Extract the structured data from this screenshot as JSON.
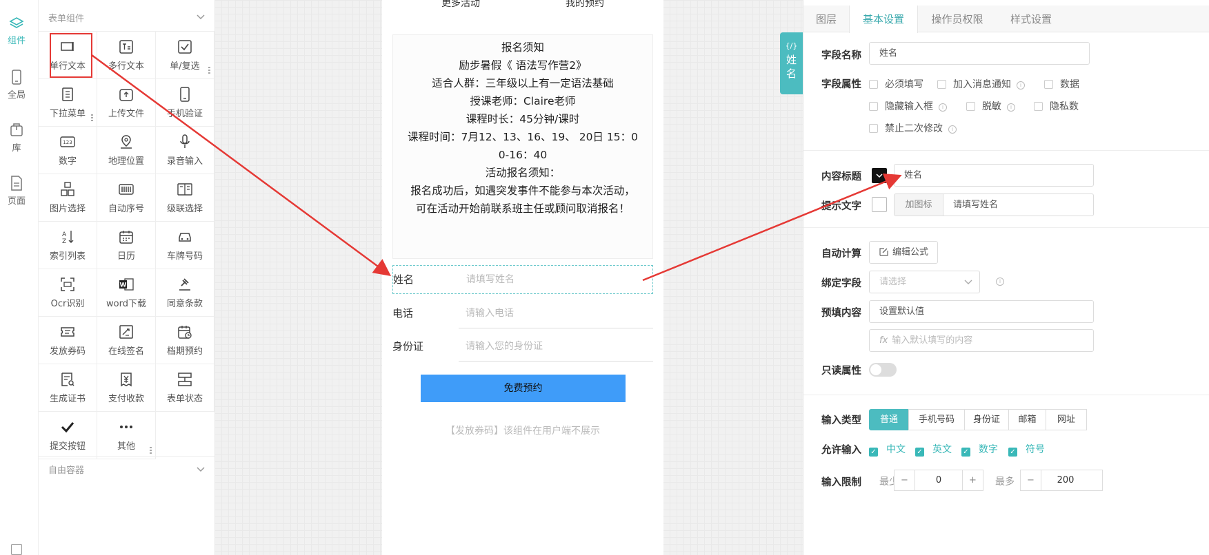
{
  "rail": {
    "items": [
      {
        "label": "组件",
        "icon": "layers-icon"
      },
      {
        "label": "全局",
        "icon": "phone-icon"
      },
      {
        "label": "库",
        "icon": "package-icon"
      },
      {
        "label": "页面",
        "icon": "page-icon"
      }
    ]
  },
  "palette": {
    "form_section": "表单组件",
    "free_section": "自由容器",
    "items": [
      {
        "label": "单行文本",
        "icon": "single-line-text-icon"
      },
      {
        "label": "多行文本",
        "icon": "multi-line-text-icon"
      },
      {
        "label": "单/复选",
        "icon": "checkbox-icon"
      },
      {
        "label": "下拉菜单",
        "icon": "dropdown-icon"
      },
      {
        "label": "上传文件",
        "icon": "upload-icon"
      },
      {
        "label": "手机验证",
        "icon": "mobile-icon"
      },
      {
        "label": "数字",
        "icon": "number-icon"
      },
      {
        "label": "地理位置",
        "icon": "location-icon"
      },
      {
        "label": "录音输入",
        "icon": "microphone-icon"
      },
      {
        "label": "图片选择",
        "icon": "image-select-icon"
      },
      {
        "label": "自动序号",
        "icon": "barcode-icon"
      },
      {
        "label": "级联选择",
        "icon": "cascade-icon"
      },
      {
        "label": "索引列表",
        "icon": "sort-az-icon"
      },
      {
        "label": "日历",
        "icon": "calendar-icon"
      },
      {
        "label": "车牌号码",
        "icon": "car-icon"
      },
      {
        "label": "Ocr识别",
        "icon": "ocr-scan-icon"
      },
      {
        "label": "word下载",
        "icon": "word-icon"
      },
      {
        "label": "同意条款",
        "icon": "gavel-icon"
      },
      {
        "label": "发放券码",
        "icon": "coupon-icon"
      },
      {
        "label": "在线签名",
        "icon": "signature-icon"
      },
      {
        "label": "档期预约",
        "icon": "schedule-icon"
      },
      {
        "label": "生成证书",
        "icon": "certificate-icon"
      },
      {
        "label": "支付收款",
        "icon": "payment-icon"
      },
      {
        "label": "表单状态",
        "icon": "form-status-icon"
      },
      {
        "label": "提交按钮",
        "icon": "checkmark-icon"
      },
      {
        "label": "其他",
        "icon": "more-icon"
      }
    ]
  },
  "canvas": {
    "top_links": [
      "更多活动",
      "我的预约"
    ],
    "notice_lines": [
      "报名须知",
      "励步暑假《 语法写作营2》",
      "适合人群：三年级以上有一定语法基础",
      "授课老师：Claire老师",
      "课程时长：45分钟/课时",
      "课程时间：7月12、13、16、19、 20日   15：0",
      "0-16：40",
      "活动报名须知：",
      "报名成功后，如遇突发事件不能参与本次活动，",
      "可在活动开始前联系班主任或顾问取消报名！"
    ],
    "fields": [
      {
        "label": "姓名",
        "placeholder": "请填写姓名"
      },
      {
        "label": "电话",
        "placeholder": "请输入电话"
      },
      {
        "label": "身份证",
        "placeholder": "请输入您的身份证"
      }
    ],
    "submit_label": "免费预约",
    "coupon_hint": "【发放券码】该组件在用户端不展示",
    "side_tab": {
      "code": "{/}",
      "name_chars": [
        "姓",
        "名"
      ]
    }
  },
  "panel": {
    "tabs": [
      "图层",
      "基本设置",
      "操作员权限",
      "样式设置"
    ],
    "active_tab": "基本设置",
    "field_name": {
      "label": "字段名称",
      "value": "姓名"
    },
    "field_attr": {
      "label": "字段属性",
      "options": [
        "必须填写",
        "加入消息通知",
        "数据",
        "隐藏输入框",
        "脱敏",
        "隐私数",
        "禁止二次修改"
      ]
    },
    "content_title": {
      "label": "内容标题",
      "value": "姓名"
    },
    "hint_text": {
      "label": "提示文字",
      "add_icon": "加图标",
      "value": "请填写姓名"
    },
    "auto_calc": {
      "label": "自动计算",
      "button": "编辑公式"
    },
    "bind_field": {
      "label": "绑定字段",
      "placeholder": "请选择"
    },
    "prefill": {
      "label": "预填内容",
      "value": "设置默认值",
      "formula_placeholder": "输入默认填写的内容"
    },
    "readonly": {
      "label": "只读属性",
      "on": false
    },
    "input_type": {
      "label": "输入类型",
      "options": [
        "普通",
        "手机号码",
        "身份证",
        "邮箱",
        "网址"
      ],
      "selected": "普通"
    },
    "allow_input": {
      "label": "允许输入",
      "options": [
        "中文",
        "英文",
        "数字",
        "符号"
      ]
    },
    "input_limit": {
      "label": "输入限制",
      "min_label": "最少",
      "min": "0",
      "max_label": "最多",
      "max": "200"
    }
  },
  "colors": {
    "accent": "#39b8b8",
    "submit": "#3f9cf9",
    "arrow": "#e53935",
    "highlight_box": "#e53935"
  }
}
